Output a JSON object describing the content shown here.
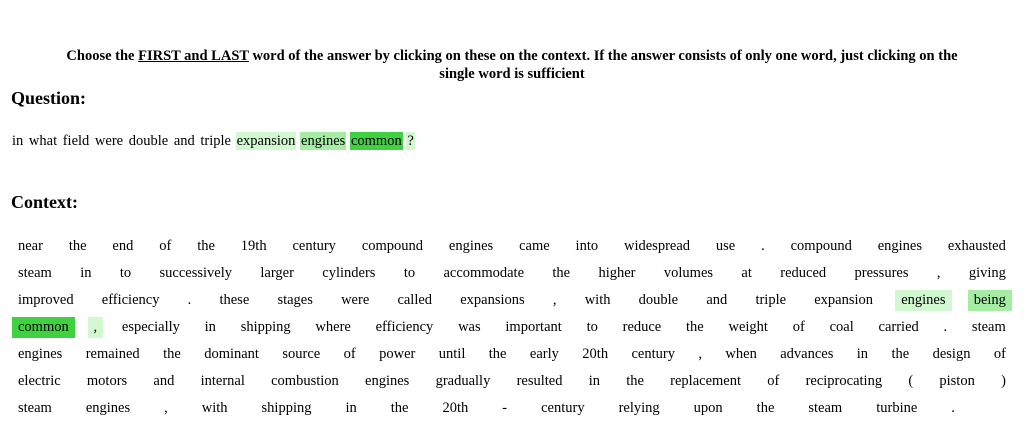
{
  "instructions": {
    "prefix": "Choose the ",
    "emphasis": "FIRST and LAST",
    "suffix": " word of the answer by clicking on these on the context. If the answer consists of only one word, just clicking on the",
    "line2": "single word is sufficient"
  },
  "question_heading": "Question:",
  "question_tokens": [
    {
      "t": "in"
    },
    {
      "t": "what"
    },
    {
      "t": "field"
    },
    {
      "t": "were"
    },
    {
      "t": "double"
    },
    {
      "t": "and"
    },
    {
      "t": "triple"
    },
    {
      "t": "expansion",
      "hl": "light"
    },
    {
      "t": "engines",
      "hl": "mid"
    },
    {
      "t": "common",
      "hl": "strong"
    },
    {
      "t": "?",
      "hl": "light"
    }
  ],
  "context_heading": "Context:",
  "context_lines": [
    [
      {
        "t": "near"
      },
      {
        "t": "the"
      },
      {
        "t": "end"
      },
      {
        "t": "of"
      },
      {
        "t": "the"
      },
      {
        "t": "19th"
      },
      {
        "t": "century"
      },
      {
        "t": "compound"
      },
      {
        "t": "engines"
      },
      {
        "t": "came"
      },
      {
        "t": "into"
      },
      {
        "t": "widespread"
      },
      {
        "t": "use"
      },
      {
        "t": "."
      },
      {
        "t": "compound"
      },
      {
        "t": "engines"
      },
      {
        "t": "exhausted"
      }
    ],
    [
      {
        "t": "steam"
      },
      {
        "t": "in"
      },
      {
        "t": "to"
      },
      {
        "t": "successively"
      },
      {
        "t": "larger"
      },
      {
        "t": "cylinders"
      },
      {
        "t": "to"
      },
      {
        "t": "accommodate"
      },
      {
        "t": "the"
      },
      {
        "t": "higher"
      },
      {
        "t": "volumes"
      },
      {
        "t": "at"
      },
      {
        "t": "reduced"
      },
      {
        "t": "pressures"
      },
      {
        "t": ","
      },
      {
        "t": "giving"
      }
    ],
    [
      {
        "t": "improved"
      },
      {
        "t": "efficiency"
      },
      {
        "t": "."
      },
      {
        "t": "these"
      },
      {
        "t": "stages"
      },
      {
        "t": "were"
      },
      {
        "t": "called"
      },
      {
        "t": "expansions"
      },
      {
        "t": ","
      },
      {
        "t": "with"
      },
      {
        "t": "double"
      },
      {
        "t": "and"
      },
      {
        "t": "triple"
      },
      {
        "t": "expansion"
      },
      {
        "t": "engines",
        "hl": "light"
      },
      {
        "t": "being",
        "hl": "mid"
      }
    ],
    [
      {
        "t": "common",
        "hl": "strong"
      },
      {
        "t": ",",
        "hl": "light"
      },
      {
        "t": "especially"
      },
      {
        "t": "in"
      },
      {
        "t": "shipping"
      },
      {
        "t": "where"
      },
      {
        "t": "efficiency"
      },
      {
        "t": "was"
      },
      {
        "t": "important"
      },
      {
        "t": "to"
      },
      {
        "t": "reduce"
      },
      {
        "t": "the"
      },
      {
        "t": "weight"
      },
      {
        "t": "of"
      },
      {
        "t": "coal"
      },
      {
        "t": "carried"
      },
      {
        "t": "."
      },
      {
        "t": "steam"
      }
    ],
    [
      {
        "t": "engines"
      },
      {
        "t": "remained"
      },
      {
        "t": "the"
      },
      {
        "t": "dominant"
      },
      {
        "t": "source"
      },
      {
        "t": "of"
      },
      {
        "t": "power"
      },
      {
        "t": "until"
      },
      {
        "t": "the"
      },
      {
        "t": "early"
      },
      {
        "t": "20th"
      },
      {
        "t": "century"
      },
      {
        "t": ","
      },
      {
        "t": "when"
      },
      {
        "t": "advances"
      },
      {
        "t": "in"
      },
      {
        "t": "the"
      },
      {
        "t": "design"
      },
      {
        "t": "of"
      }
    ],
    [
      {
        "t": "electric"
      },
      {
        "t": "motors"
      },
      {
        "t": "and"
      },
      {
        "t": "internal"
      },
      {
        "t": "combustion"
      },
      {
        "t": "engines"
      },
      {
        "t": "gradually"
      },
      {
        "t": "resulted"
      },
      {
        "t": "in"
      },
      {
        "t": "the"
      },
      {
        "t": "replacement"
      },
      {
        "t": "of"
      },
      {
        "t": "reciprocating"
      },
      {
        "t": "("
      },
      {
        "t": "piston"
      },
      {
        "t": ")"
      }
    ],
    [
      {
        "t": "steam"
      },
      {
        "t": "engines"
      },
      {
        "t": ","
      },
      {
        "t": "with"
      },
      {
        "t": "shipping"
      },
      {
        "t": "in"
      },
      {
        "t": "the"
      },
      {
        "t": "20th"
      },
      {
        "t": "-"
      },
      {
        "t": "century"
      },
      {
        "t": "relying"
      },
      {
        "t": "upon"
      },
      {
        "t": "the"
      },
      {
        "t": "steam"
      },
      {
        "t": "turbine"
      },
      {
        "t": "."
      }
    ]
  ],
  "colors": {
    "light": "#d2f8d2",
    "mid": "#a5eda5",
    "strong": "#3fd13f"
  }
}
